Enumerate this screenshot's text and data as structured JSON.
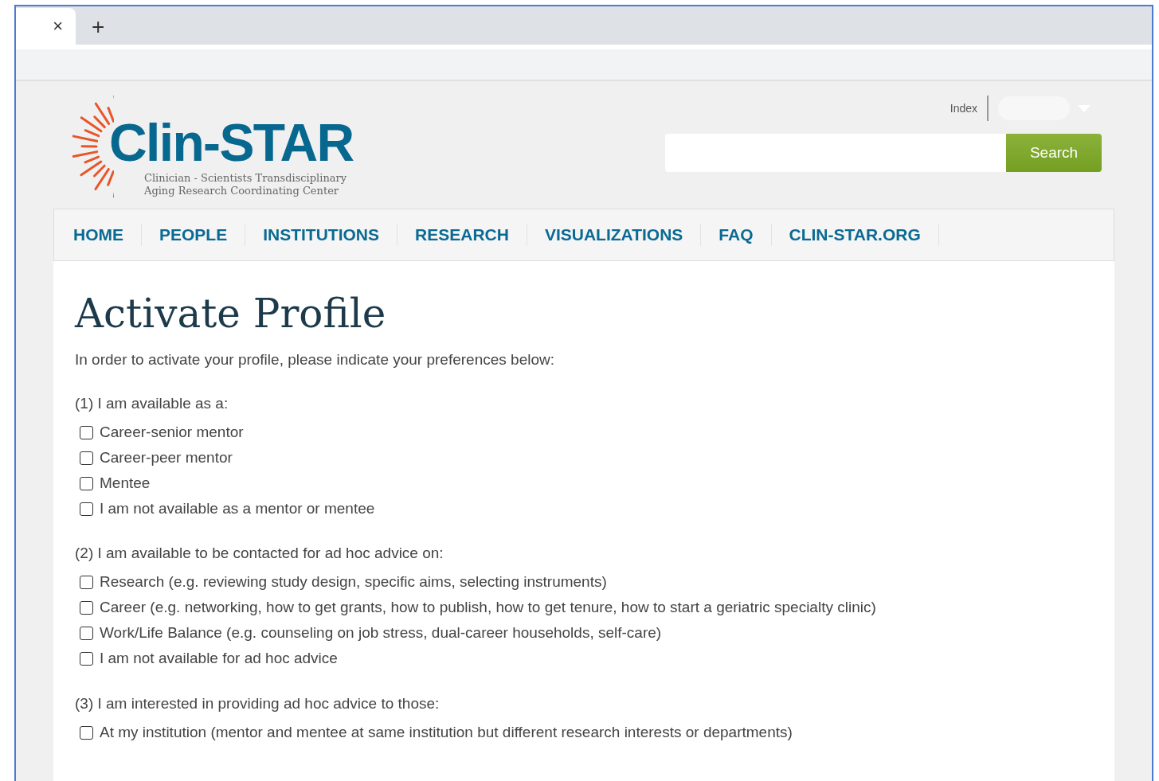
{
  "browser": {
    "tab_close": "×",
    "new_tab": "+"
  },
  "header": {
    "logo_title": "Clin-STAR",
    "logo_subtitle_1": "Clinician - Scientists Transdisciplinary",
    "logo_subtitle_2": "Aging Research Coordinating Center",
    "index_link": "Index",
    "search_button": "Search"
  },
  "nav": [
    {
      "label": "HOME"
    },
    {
      "label": "PEOPLE"
    },
    {
      "label": "INSTITUTIONS"
    },
    {
      "label": "RESEARCH"
    },
    {
      "label": "VISUALIZATIONS"
    },
    {
      "label": "FAQ"
    },
    {
      "label": "CLIN-STAR.ORG"
    }
  ],
  "page": {
    "title": "Activate Profile",
    "intro": "In order to activate your profile, please indicate your preferences below:",
    "sections": [
      {
        "question": "(1) I am available as a:",
        "options": [
          {
            "label": "Career-senior mentor",
            "checked": false
          },
          {
            "label": "Career-peer mentor",
            "checked": false
          },
          {
            "label": "Mentee",
            "checked": false
          },
          {
            "label": "I am not available as a mentor or mentee",
            "checked": false
          }
        ]
      },
      {
        "question": "(2) I am available to be contacted for ad hoc advice on:",
        "options": [
          {
            "label": "Research (e.g. reviewing study design, specific aims, selecting instruments)",
            "checked": false
          },
          {
            "label": "Career (e.g. networking, how to get grants, how to publish, how to get tenure, how to start a geriatric specialty clinic)",
            "checked": false
          },
          {
            "label": "Work/Life Balance (e.g. counseling on job stress, dual-career households, self-care)",
            "checked": false
          },
          {
            "label": "I am not available for ad hoc advice",
            "checked": false
          }
        ]
      },
      {
        "question": "(3) I am interested in providing ad hoc advice to those:",
        "options": [
          {
            "label": "At my institution (mentor and mentee at same institution but different research interests or departments)",
            "checked": false
          }
        ]
      }
    ]
  }
}
